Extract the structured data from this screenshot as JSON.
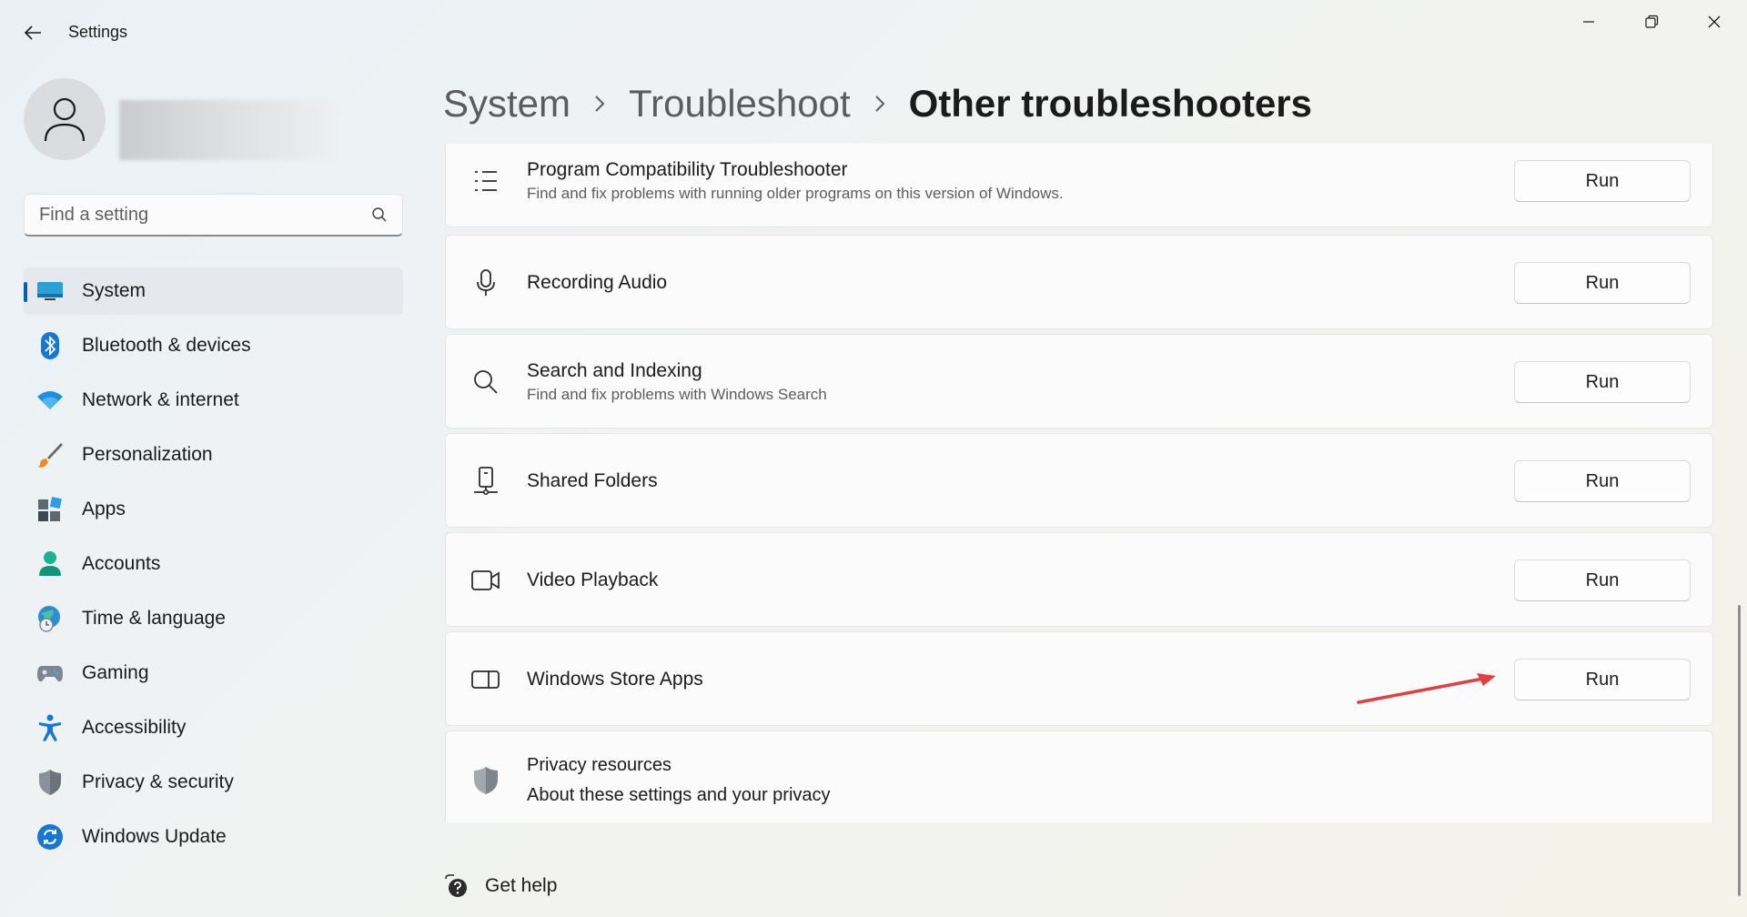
{
  "window": {
    "title": "Settings",
    "controls": [
      "minimize-icon",
      "maximize-icon",
      "close-icon"
    ]
  },
  "search": {
    "placeholder": "Find a setting",
    "value": ""
  },
  "sidebar": {
    "items": [
      {
        "label": "System",
        "icon": "system-icon",
        "active": true
      },
      {
        "label": "Bluetooth & devices",
        "icon": "bluetooth-icon"
      },
      {
        "label": "Network & internet",
        "icon": "wifi-icon"
      },
      {
        "label": "Personalization",
        "icon": "brush-icon"
      },
      {
        "label": "Apps",
        "icon": "apps-icon"
      },
      {
        "label": "Accounts",
        "icon": "accounts-icon"
      },
      {
        "label": "Time & language",
        "icon": "globe-clock-icon"
      },
      {
        "label": "Gaming",
        "icon": "gamepad-icon"
      },
      {
        "label": "Accessibility",
        "icon": "accessibility-icon"
      },
      {
        "label": "Privacy & security",
        "icon": "shield-icon"
      },
      {
        "label": "Windows Update",
        "icon": "update-icon"
      }
    ]
  },
  "breadcrumb": {
    "items": [
      "System",
      "Troubleshoot",
      "Other troubleshooters"
    ]
  },
  "troubleshooters": [
    {
      "title": "Program Compatibility Troubleshooter",
      "description": "Find and fix problems with running older programs on this version of Windows.",
      "icon": "list-icon",
      "button": "Run"
    },
    {
      "title": "Recording Audio",
      "description": "",
      "icon": "microphone-icon",
      "button": "Run"
    },
    {
      "title": "Search and Indexing",
      "description": "Find and fix problems with Windows Search",
      "icon": "search-icon",
      "button": "Run"
    },
    {
      "title": "Shared Folders",
      "description": "",
      "icon": "shared-folders-icon",
      "button": "Run"
    },
    {
      "title": "Video Playback",
      "description": "",
      "icon": "video-camera-icon",
      "button": "Run"
    },
    {
      "title": "Windows Store Apps",
      "description": "",
      "icon": "store-apps-icon",
      "button": "Run"
    }
  ],
  "privacy": {
    "title": "Privacy resources",
    "link": "About these settings and your privacy",
    "icon": "shield-icon"
  },
  "help": {
    "label": "Get help",
    "icon": "help-icon"
  },
  "colors": {
    "accent": "#005fb8",
    "annotation_arrow": "#e0403f"
  }
}
